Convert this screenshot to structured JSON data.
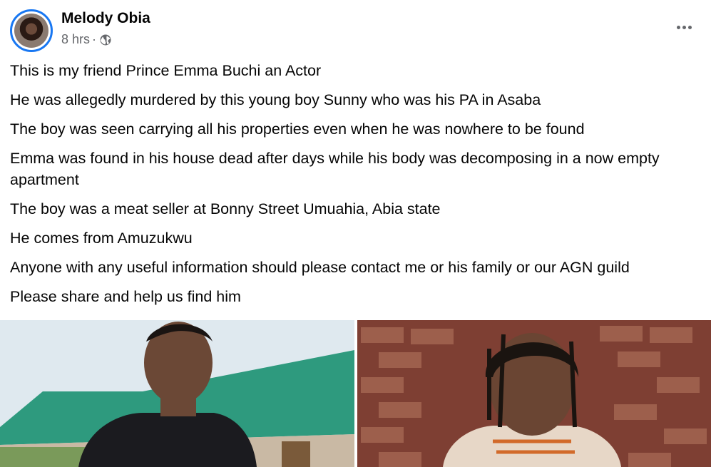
{
  "post": {
    "author": "Melody Obia",
    "time": "8 hrs",
    "separator": "·",
    "privacy_icon": "globe-icon",
    "menu_icon": "more-options-icon",
    "lines": [
      "This is my friend Prince Emma Buchi an Actor",
      "He was allegedly murdered by this young boy Sunny who was his PA in Asaba",
      "The boy was seen carrying all his properties even when he was nowhere to be found",
      "Emma was found in his house dead after days while his body was decomposing in a now empty apartment",
      "The boy was a meat seller at Bonny Street Umuahia, Abia state",
      "He comes from Amuzukwu",
      "Anyone with any useful information should please contact me or his family or our AGN guild",
      "Please share and help us find him"
    ]
  },
  "colors": {
    "avatar_ring": "#1877f2",
    "meta_text": "#65676b",
    "body_text": "#050505",
    "roof_green": "#2e9a7e"
  }
}
